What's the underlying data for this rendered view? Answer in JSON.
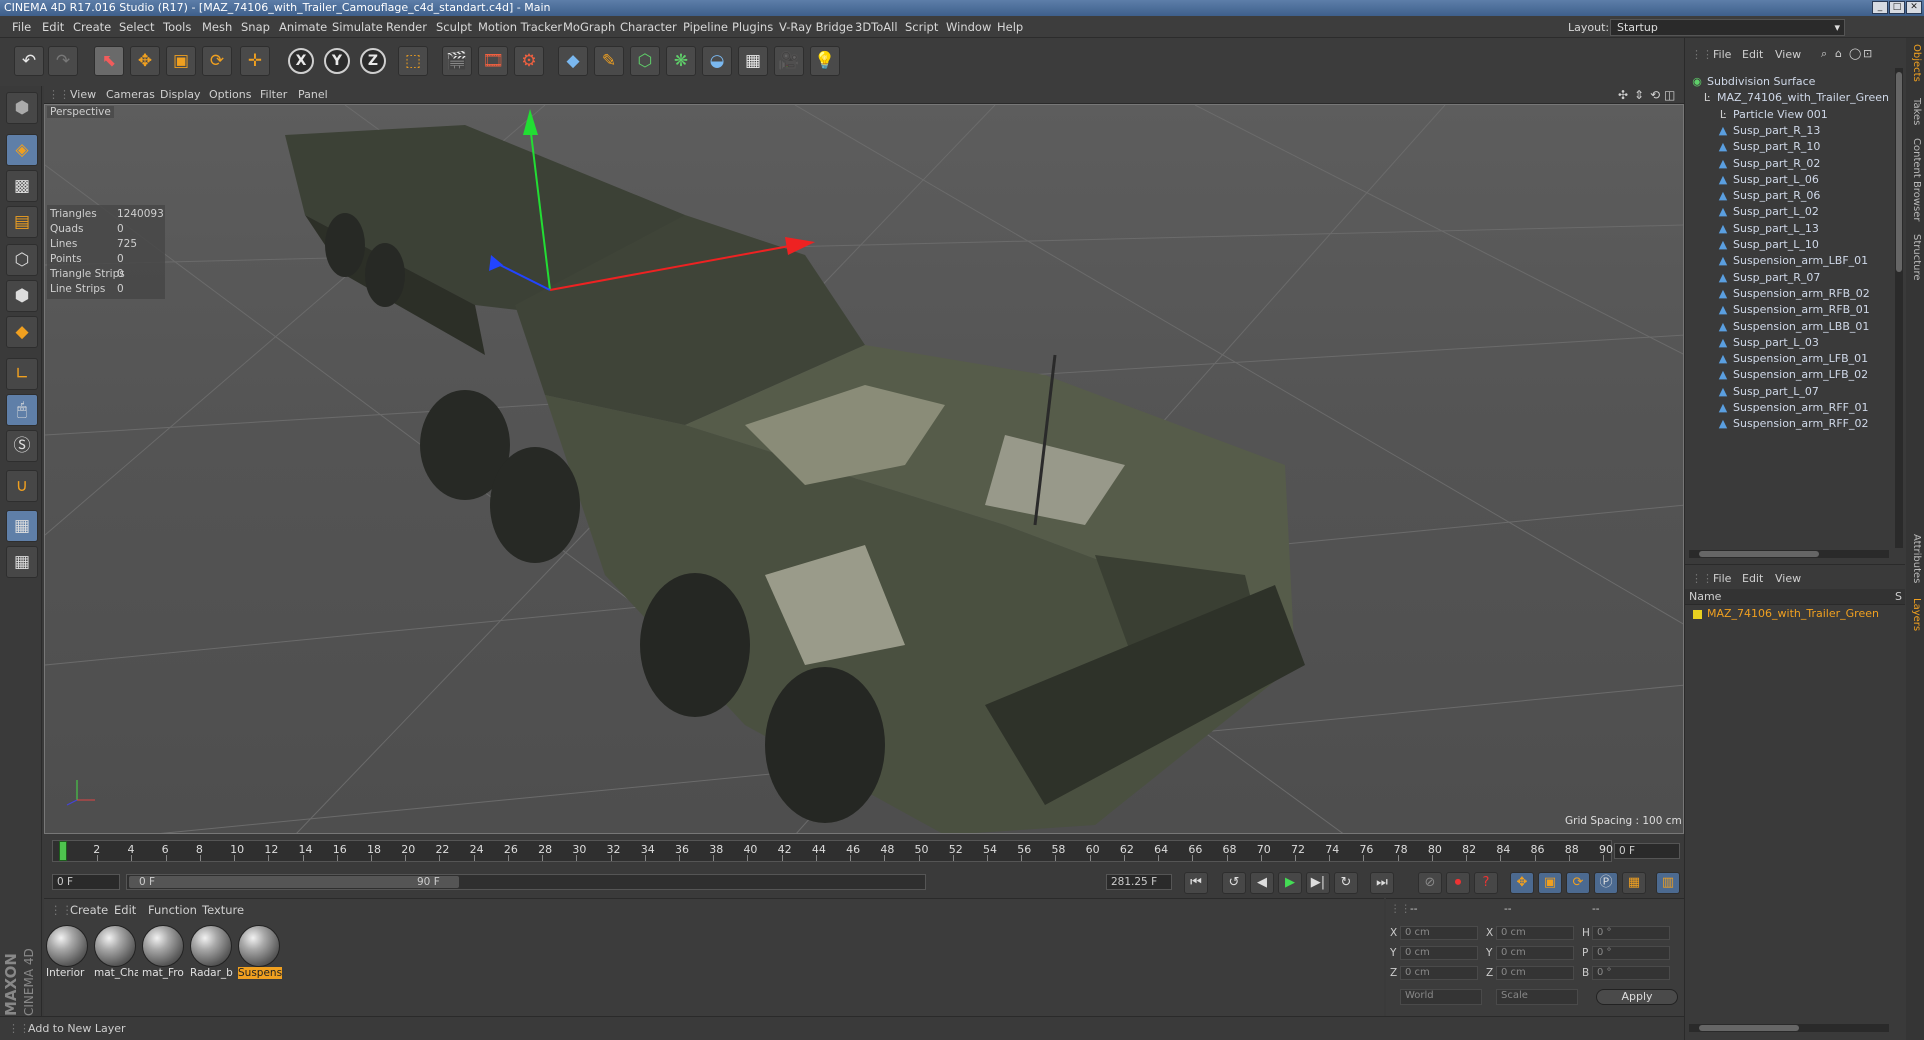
{
  "window": {
    "title": "CINEMA 4D R17.016 Studio (R17) - [MAZ_74106_with_Trailer_Camouflage_c4d_standart.c4d] - Main"
  },
  "menubar": {
    "items": [
      "File",
      "Edit",
      "Create",
      "Select",
      "Tools",
      "Mesh",
      "Snap",
      "Animate",
      "Simulate",
      "Render",
      "Sculpt",
      "Motion Tracker",
      "MoGraph",
      "Character",
      "Pipeline",
      "Plugins",
      "V-Ray Bridge",
      "3DToAll",
      "Script",
      "Window",
      "Help"
    ],
    "layout_label": "Layout:",
    "layout_value": "Startup"
  },
  "viewport": {
    "menu": [
      "View",
      "Cameras",
      "Display",
      "Options",
      "Filter",
      "Panel"
    ],
    "label": "Perspective",
    "grid_spacing": "Grid Spacing : 100 cm",
    "stats": [
      {
        "label": "Triangles",
        "value": "1240093"
      },
      {
        "label": "Quads",
        "value": "0"
      },
      {
        "label": "Lines",
        "value": "725"
      },
      {
        "label": "Points",
        "value": "0"
      },
      {
        "label": "Triangle Strips",
        "value": "0"
      },
      {
        "label": "Line Strips",
        "value": "0"
      }
    ]
  },
  "timeline": {
    "ticks": [
      "0",
      "2",
      "4",
      "6",
      "8",
      "10",
      "12",
      "14",
      "16",
      "18",
      "20",
      "22",
      "24",
      "26",
      "28",
      "30",
      "32",
      "34",
      "36",
      "38",
      "40",
      "42",
      "44",
      "46",
      "48",
      "50",
      "52",
      "54",
      "56",
      "58",
      "60",
      "62",
      "64",
      "66",
      "68",
      "70",
      "72",
      "74",
      "76",
      "78",
      "80",
      "82",
      "84",
      "86",
      "88",
      "90"
    ],
    "current_frame": "0 F",
    "start_frame": "0 F",
    "range_start": "0 F",
    "range_end": "90 F",
    "fps_value": "281.25 F"
  },
  "materials": {
    "menu": [
      "Create",
      "Edit",
      "Function",
      "Texture"
    ],
    "items": [
      {
        "label": "Interior"
      },
      {
        "label": "mat_Cha"
      },
      {
        "label": "mat_Fro"
      },
      {
        "label": "Radar_b"
      },
      {
        "label": "Suspensi"
      }
    ]
  },
  "coords": {
    "headers": [
      "--",
      "--",
      "--"
    ],
    "rows": [
      {
        "a": "X",
        "av": "0 cm",
        "b": "X",
        "bv": "0 cm",
        "c": "H",
        "cv": "0 °"
      },
      {
        "a": "Y",
        "av": "0 cm",
        "b": "Y",
        "bv": "0 cm",
        "c": "P",
        "cv": "0 °"
      },
      {
        "a": "Z",
        "av": "0 cm",
        "b": "Z",
        "bv": "0 cm",
        "c": "B",
        "cv": "0 °"
      }
    ],
    "world": "World",
    "scale": "Scale",
    "apply": "Apply"
  },
  "status": "Add to New Layer",
  "objects": {
    "menu": [
      "File",
      "Edit",
      "View"
    ],
    "items": [
      "Subdivision Surface",
      "MAZ_74106_with_Trailer_Green",
      "Particle View 001",
      "Susp_part_R_13",
      "Susp_part_R_10",
      "Susp_part_R_02",
      "Susp_part_L_06",
      "Susp_part_R_06",
      "Susp_part_L_02",
      "Susp_part_L_13",
      "Susp_part_L_10",
      "Suspension_arm_LBF_01",
      "Susp_part_R_07",
      "Suspension_arm_RFB_02",
      "Suspension_arm_RFB_01",
      "Suspension_arm_LBB_01",
      "Susp_part_L_03",
      "Suspension_arm_LFB_01",
      "Suspension_arm_LFB_02",
      "Susp_part_L_07",
      "Suspension_arm_RFF_01",
      "Suspension_arm_RFF_02"
    ]
  },
  "layers": {
    "menu": [
      "File",
      "Edit",
      "View"
    ],
    "column": "Name",
    "column_s": "S",
    "item": "MAZ_74106_with_Trailer_Green"
  },
  "sidetabs_top": [
    "Objects",
    "Takes",
    "Content Browser",
    "Structure"
  ],
  "sidetabs_bottom": [
    "Attributes",
    "Layers"
  ],
  "brand": [
    "MAXON",
    "CINEMA 4D"
  ]
}
